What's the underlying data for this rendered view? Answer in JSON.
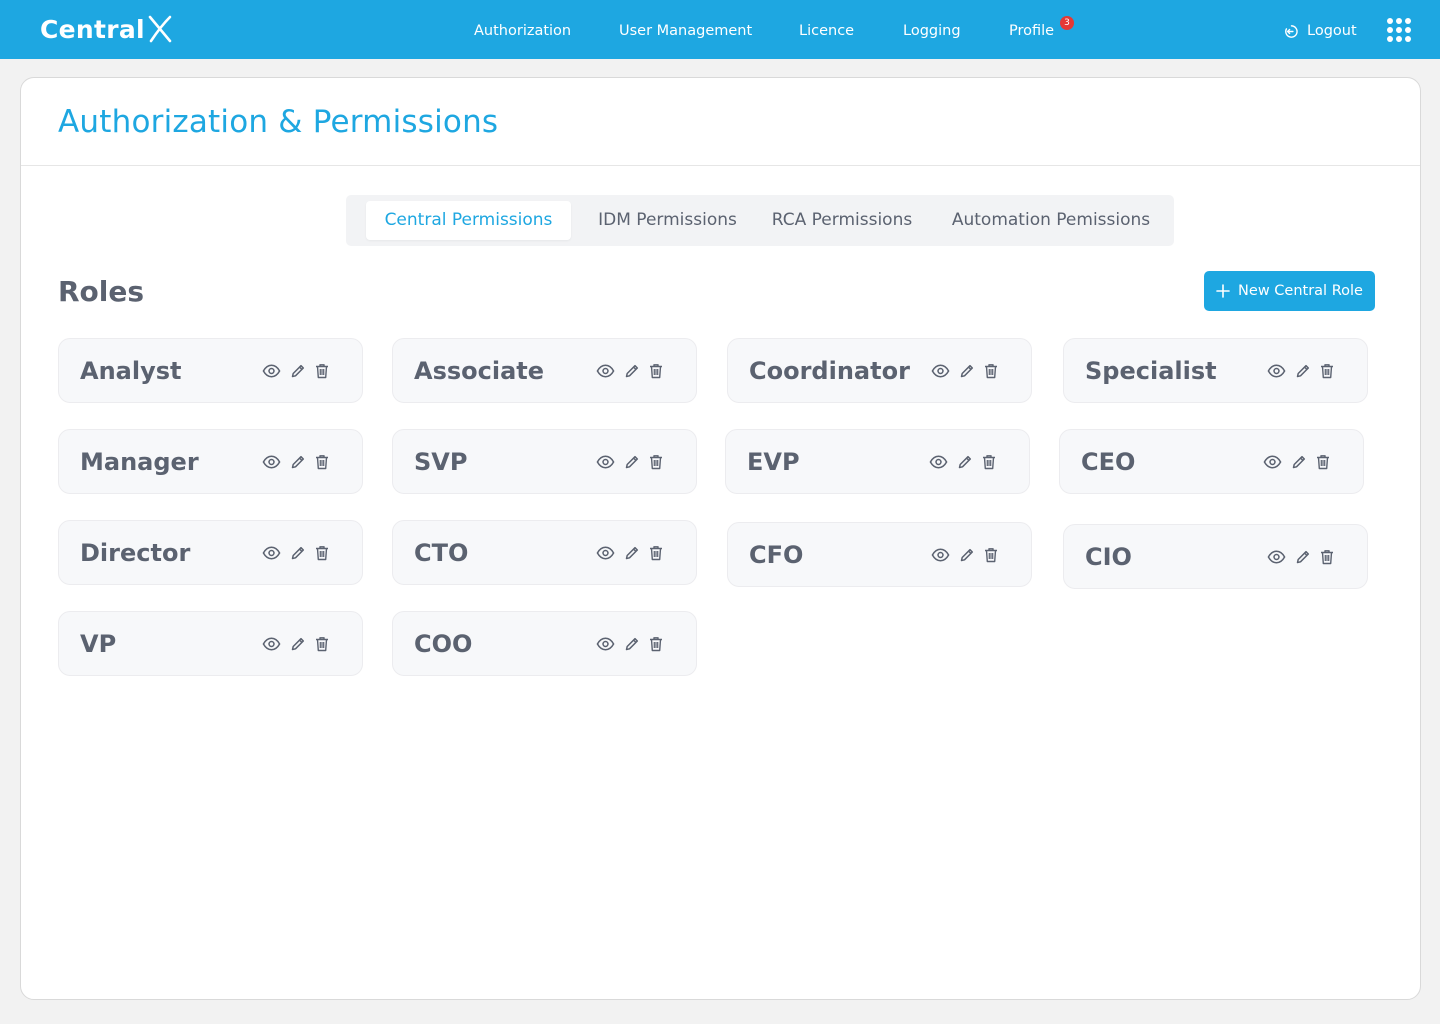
{
  "brand": {
    "name": "Central"
  },
  "nav": {
    "items": [
      {
        "label": "Authorization"
      },
      {
        "label": "User Management"
      },
      {
        "label": "Licence"
      },
      {
        "label": "Logging"
      },
      {
        "label": "Profile",
        "badge": "3"
      }
    ],
    "logout_label": "Logout"
  },
  "page": {
    "title": "Authorization & Permissions"
  },
  "tabs": [
    {
      "label": "Central Permissions",
      "active": true
    },
    {
      "label": "IDM Permissions",
      "active": false
    },
    {
      "label": "RCA Permissions",
      "active": false
    },
    {
      "label": "Automation Pemissions",
      "active": false
    }
  ],
  "roles_section": {
    "heading": "Roles",
    "new_button_label": "New Central Role"
  },
  "roles": [
    {
      "name": "Analyst"
    },
    {
      "name": "Associate"
    },
    {
      "name": "Coordinator"
    },
    {
      "name": "Specialist"
    },
    {
      "name": "Manager"
    },
    {
      "name": "SVP"
    },
    {
      "name": "EVP"
    },
    {
      "name": "CEO"
    },
    {
      "name": "Director"
    },
    {
      "name": "CTO"
    },
    {
      "name": "CFO"
    },
    {
      "name": "CIO"
    },
    {
      "name": "VP"
    },
    {
      "name": "COO"
    }
  ],
  "colors": {
    "primary": "#1ea7e1",
    "badge": "#e53935",
    "text": "#5b6270"
  },
  "icons": {
    "role_actions": [
      "eye-icon",
      "pencil-icon",
      "trash-icon"
    ]
  }
}
